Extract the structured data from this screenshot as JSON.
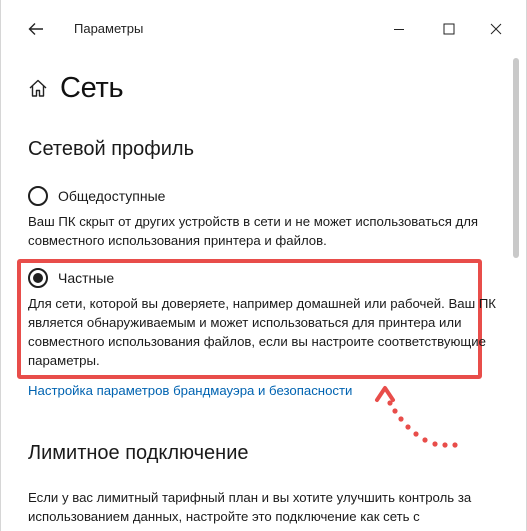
{
  "window": {
    "title": "Параметры"
  },
  "page": {
    "title": "Сеть"
  },
  "network_profile": {
    "section_title": "Сетевой профиль",
    "public": {
      "label": "Общедоступные",
      "selected": false,
      "description": "Ваш ПК скрыт от других устройств в сети и не может использоваться для совместного использования принтера и файлов."
    },
    "private": {
      "label": "Частные",
      "selected": true,
      "description": "Для сети, которой вы доверяете, например домашней или рабочей. Ваш ПК является обнаруживаемым и может использоваться для принтера или совместного использования файлов, если вы настроите соответствующие параметры."
    },
    "firewall_link": "Настройка параметров брандмауэра и безопасности"
  },
  "metered": {
    "section_title": "Лимитное подключение",
    "description": "Если у вас лимитный тарифный план и вы хотите улучшить контроль за использованием данных, настройте это подключение как сеть с"
  },
  "colors": {
    "highlight": "#e84d4a",
    "link": "#0063b1"
  },
  "icons": {
    "back": "back-arrow-icon",
    "home": "home-icon",
    "minimize": "minimize-icon",
    "maximize": "maximize-icon",
    "close": "close-icon"
  }
}
